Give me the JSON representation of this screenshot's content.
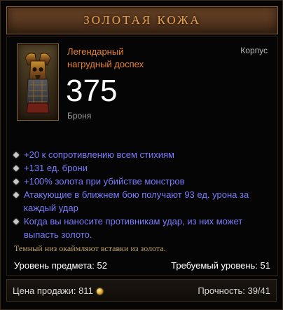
{
  "item": {
    "name": "ЗОЛОТАЯ КОЖА",
    "type_line1": "Легендарный",
    "type_line2": "нагрудный доспех",
    "slot": "Корпус",
    "armor_value": "375",
    "armor_label": "Броня",
    "icon": "chest-armor-icon"
  },
  "affixes": [
    {
      "text": "+20 к сопротивлению всем стихиям",
      "color": "#7b7bff"
    },
    {
      "text": "+131 ед. брони",
      "color": "#7b7bff"
    },
    {
      "text": "+100% золота при убийстве монстров",
      "color": "#7b7bff"
    },
    {
      "text": "Атакующие в ближнем бою получают 93 ед. урона за каждый удар",
      "color": "#7b7bff"
    },
    {
      "text": "Когда вы наносите противникам удар, из них может выпасть золото.",
      "color": "#7b7bff"
    }
  ],
  "flavor_text": "Темный низ окаймляют вставки из золота.",
  "requirements": {
    "item_level": "Уровень предмета: 52",
    "required_level": "Требуемый уровень: 51"
  },
  "footer": {
    "sell_price_label": "Цена продажи: 811",
    "gold_icon": "gold-coin-icon",
    "durability": "Прочность: 39/41"
  },
  "colors": {
    "legendary": "#e8812f",
    "affix_blue": "#7b7bff",
    "flavor": "#c2a26a",
    "header": "#e8a24f"
  }
}
